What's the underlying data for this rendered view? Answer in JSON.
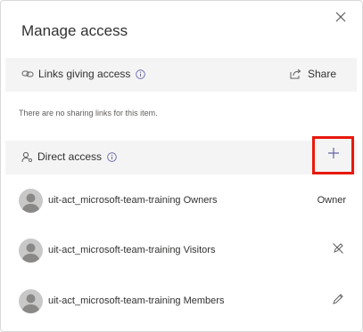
{
  "dialog": {
    "title": "Manage access",
    "links_section": {
      "label": "Links giving access",
      "share_label": "Share",
      "empty_message": "There are no sharing links for this item."
    },
    "direct_section": {
      "label": "Direct access",
      "add_icon": "plus-icon"
    },
    "members": [
      {
        "name": "uit-act_microsoft-team-training Owners",
        "role": "Owner",
        "icon": ""
      },
      {
        "name": "uit-act_microsoft-team-training Visitors",
        "role": "",
        "icon": "no-edit-icon"
      },
      {
        "name": "uit-act_microsoft-team-training Members",
        "role": "",
        "icon": "edit-pencil-icon"
      }
    ]
  },
  "colors": {
    "accent": "#6264a7",
    "highlight": "#e8180c",
    "section_bg": "#f4f4f4"
  }
}
